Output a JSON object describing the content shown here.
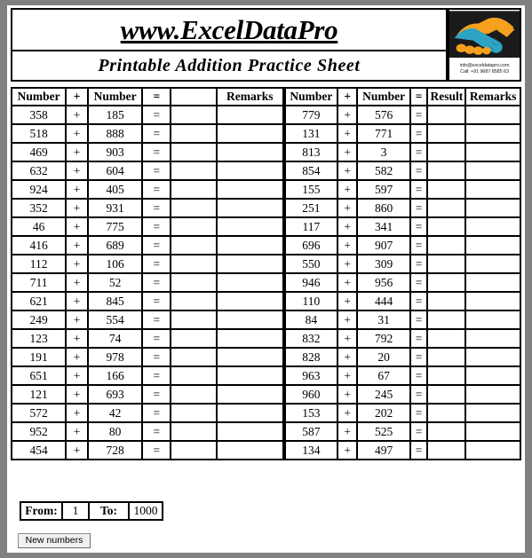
{
  "header": {
    "site_title": "www.ExcelDataPro",
    "sheet_title": "Printable Addition Practice Sheet",
    "logo": {
      "icon_name": "handshake-logo",
      "email": "info@exceldatapro.com",
      "phone": "Call: +91 9687 8585 63",
      "colors": {
        "orange": "#f5a01e",
        "teal": "#2ea3c6",
        "dark": "#1b1b1b"
      }
    }
  },
  "left_table": {
    "headers": [
      "Number",
      "+",
      "Number",
      "=",
      "",
      "Remarks"
    ],
    "rows": [
      {
        "a": "358",
        "op": "+",
        "b": "185",
        "eq": "=",
        "result": "",
        "remarks": ""
      },
      {
        "a": "518",
        "op": "+",
        "b": "888",
        "eq": "=",
        "result": "",
        "remarks": ""
      },
      {
        "a": "469",
        "op": "+",
        "b": "903",
        "eq": "=",
        "result": "",
        "remarks": ""
      },
      {
        "a": "632",
        "op": "+",
        "b": "604",
        "eq": "=",
        "result": "",
        "remarks": ""
      },
      {
        "a": "924",
        "op": "+",
        "b": "405",
        "eq": "=",
        "result": "",
        "remarks": ""
      },
      {
        "a": "352",
        "op": "+",
        "b": "931",
        "eq": "=",
        "result": "",
        "remarks": ""
      },
      {
        "a": "46",
        "op": "+",
        "b": "775",
        "eq": "=",
        "result": "",
        "remarks": ""
      },
      {
        "a": "416",
        "op": "+",
        "b": "689",
        "eq": "=",
        "result": "",
        "remarks": ""
      },
      {
        "a": "112",
        "op": "+",
        "b": "106",
        "eq": "=",
        "result": "",
        "remarks": ""
      },
      {
        "a": "711",
        "op": "+",
        "b": "52",
        "eq": "=",
        "result": "",
        "remarks": ""
      },
      {
        "a": "621",
        "op": "+",
        "b": "845",
        "eq": "=",
        "result": "",
        "remarks": ""
      },
      {
        "a": "249",
        "op": "+",
        "b": "554",
        "eq": "=",
        "result": "",
        "remarks": ""
      },
      {
        "a": "123",
        "op": "+",
        "b": "74",
        "eq": "=",
        "result": "",
        "remarks": ""
      },
      {
        "a": "191",
        "op": "+",
        "b": "978",
        "eq": "=",
        "result": "",
        "remarks": ""
      },
      {
        "a": "651",
        "op": "+",
        "b": "166",
        "eq": "=",
        "result": "",
        "remarks": ""
      },
      {
        "a": "121",
        "op": "+",
        "b": "693",
        "eq": "=",
        "result": "",
        "remarks": ""
      },
      {
        "a": "572",
        "op": "+",
        "b": "42",
        "eq": "=",
        "result": "",
        "remarks": ""
      },
      {
        "a": "952",
        "op": "+",
        "b": "80",
        "eq": "=",
        "result": "",
        "remarks": ""
      },
      {
        "a": "454",
        "op": "+",
        "b": "728",
        "eq": "=",
        "result": "",
        "remarks": ""
      }
    ]
  },
  "right_table": {
    "headers": [
      "Number",
      "+",
      "Number",
      "=",
      "Result",
      "Remarks"
    ],
    "rows": [
      {
        "a": "779",
        "op": "+",
        "b": "576",
        "eq": "=",
        "result": "",
        "remarks": ""
      },
      {
        "a": "131",
        "op": "+",
        "b": "771",
        "eq": "=",
        "result": "",
        "remarks": ""
      },
      {
        "a": "813",
        "op": "+",
        "b": "3",
        "eq": "=",
        "result": "",
        "remarks": ""
      },
      {
        "a": "854",
        "op": "+",
        "b": "582",
        "eq": "=",
        "result": "",
        "remarks": ""
      },
      {
        "a": "155",
        "op": "+",
        "b": "597",
        "eq": "=",
        "result": "",
        "remarks": ""
      },
      {
        "a": "251",
        "op": "+",
        "b": "860",
        "eq": "=",
        "result": "",
        "remarks": ""
      },
      {
        "a": "117",
        "op": "+",
        "b": "341",
        "eq": "=",
        "result": "",
        "remarks": ""
      },
      {
        "a": "696",
        "op": "+",
        "b": "907",
        "eq": "=",
        "result": "",
        "remarks": ""
      },
      {
        "a": "550",
        "op": "+",
        "b": "309",
        "eq": "=",
        "result": "",
        "remarks": ""
      },
      {
        "a": "946",
        "op": "+",
        "b": "956",
        "eq": "=",
        "result": "",
        "remarks": ""
      },
      {
        "a": "110",
        "op": "+",
        "b": "444",
        "eq": "=",
        "result": "",
        "remarks": ""
      },
      {
        "a": "84",
        "op": "+",
        "b": "31",
        "eq": "=",
        "result": "",
        "remarks": ""
      },
      {
        "a": "832",
        "op": "+",
        "b": "792",
        "eq": "=",
        "result": "",
        "remarks": ""
      },
      {
        "a": "828",
        "op": "+",
        "b": "20",
        "eq": "=",
        "result": "",
        "remarks": ""
      },
      {
        "a": "963",
        "op": "+",
        "b": "67",
        "eq": "=",
        "result": "",
        "remarks": ""
      },
      {
        "a": "960",
        "op": "+",
        "b": "245",
        "eq": "=",
        "result": "",
        "remarks": ""
      },
      {
        "a": "153",
        "op": "+",
        "b": "202",
        "eq": "=",
        "result": "",
        "remarks": ""
      },
      {
        "a": "587",
        "op": "+",
        "b": "525",
        "eq": "=",
        "result": "",
        "remarks": ""
      },
      {
        "a": "134",
        "op": "+",
        "b": "497",
        "eq": "=",
        "result": "",
        "remarks": ""
      }
    ]
  },
  "footer": {
    "from_label": "From:",
    "from_value": "1",
    "to_label": "To:",
    "to_value": "1000",
    "new_numbers_button": "New numbers"
  }
}
